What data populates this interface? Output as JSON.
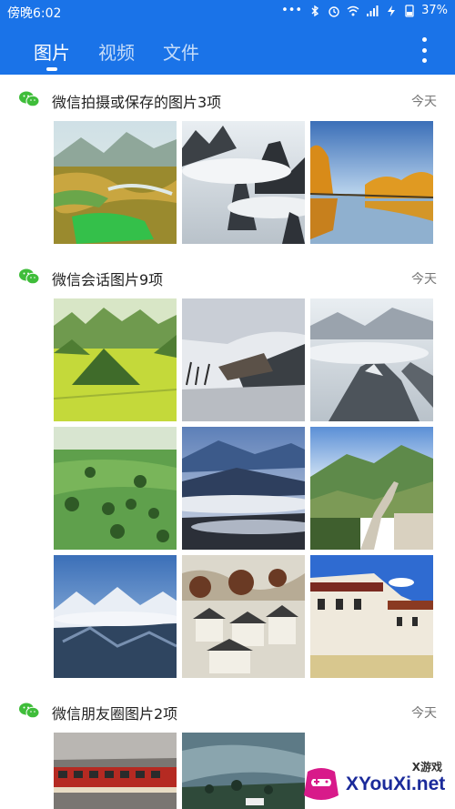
{
  "status_bar": {
    "time": "傍晚6:02",
    "battery": "37%"
  },
  "tabs": [
    {
      "label": "图片",
      "active": true
    },
    {
      "label": "视频",
      "active": false
    },
    {
      "label": "文件",
      "active": false
    }
  ],
  "sections": [
    {
      "title": "微信拍摄或保存的图片3项",
      "date": "今天",
      "image_count_shown": 3
    },
    {
      "title": "微信会话图片9项",
      "date": "今天",
      "image_count_shown": 9
    },
    {
      "title": "微信朋友圈图片2项",
      "date": "今天",
      "image_count_shown": 2
    }
  ],
  "watermark": {
    "top_text": "X游戏",
    "site": "XYouXi.net"
  },
  "colors": {
    "app_bar": "#1a73e8",
    "wechat_icon": "#3fbd3a",
    "watermark_text": "#1a2a9a"
  }
}
